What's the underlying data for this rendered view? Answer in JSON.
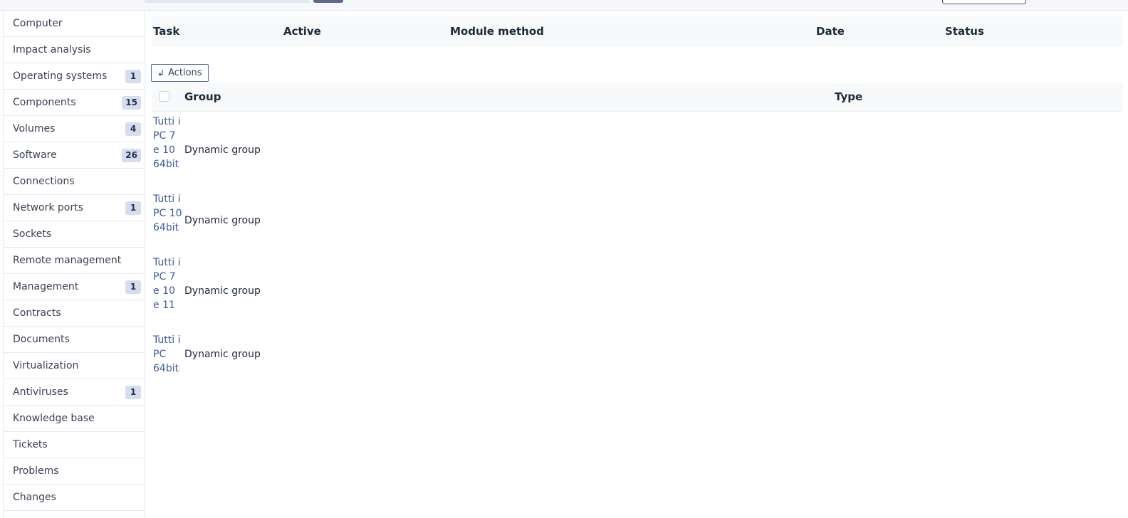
{
  "sidebar": {
    "items": [
      {
        "label": "Computer",
        "badge": ""
      },
      {
        "label": "Impact analysis",
        "badge": ""
      },
      {
        "label": "Operating systems",
        "badge": "1"
      },
      {
        "label": "Components",
        "badge": "15"
      },
      {
        "label": "Volumes",
        "badge": "4"
      },
      {
        "label": "Software",
        "badge": "26"
      },
      {
        "label": "Connections",
        "badge": ""
      },
      {
        "label": "Network ports",
        "badge": "1"
      },
      {
        "label": "Sockets",
        "badge": ""
      },
      {
        "label": "Remote management",
        "badge": ""
      },
      {
        "label": "Management",
        "badge": "1"
      },
      {
        "label": "Contracts",
        "badge": ""
      },
      {
        "label": "Documents",
        "badge": ""
      },
      {
        "label": "Virtualization",
        "badge": ""
      },
      {
        "label": "Antiviruses",
        "badge": "1"
      },
      {
        "label": "Knowledge base",
        "badge": ""
      },
      {
        "label": "Tickets",
        "badge": ""
      },
      {
        "label": "Problems",
        "badge": ""
      },
      {
        "label": "Changes",
        "badge": ""
      }
    ]
  },
  "tasks_table": {
    "headers": {
      "task": "Task",
      "active": "Active",
      "module_method": "Module method",
      "date": "Date",
      "status": "Status"
    }
  },
  "actions_label": "Actions",
  "groups_table": {
    "headers": {
      "group": "Group",
      "type": "Type"
    },
    "rows": [
      {
        "group": "Tutti i PC 7 e 10 64bit",
        "type": "Dynamic group"
      },
      {
        "group": "Tutti i PC 10 64bit",
        "type": "Dynamic group"
      },
      {
        "group": "Tutti i PC 7 e 10 e 11",
        "type": "Dynamic group"
      },
      {
        "group": "Tutti i PC 64bit",
        "type": "Dynamic group"
      }
    ]
  }
}
